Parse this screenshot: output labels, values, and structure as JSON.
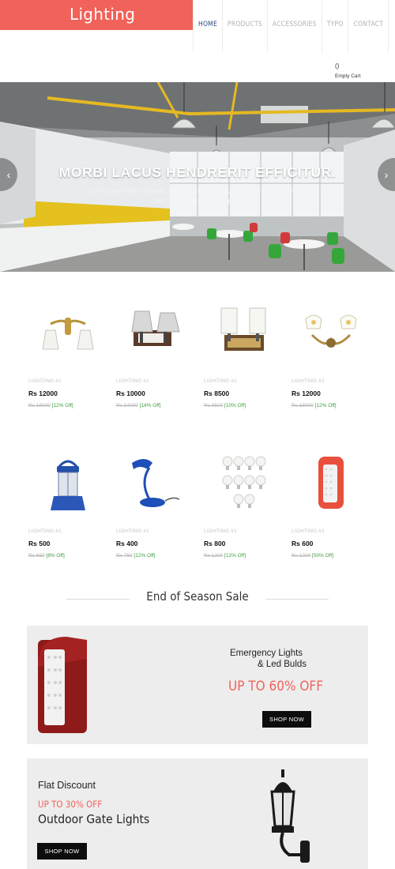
{
  "header": {
    "logo": "Lighting",
    "nav": [
      "HOME",
      "PRODUCTS",
      "ACCESSORIES",
      "TYPO",
      "CONTACT"
    ],
    "cart_count": "()",
    "cart_label": "Empty Cart"
  },
  "hero": {
    "title": "MORBI LACUS HENDRERIT EFFICITUR.",
    "subtitle": "Lorem ipsum dolor sit amet, consectetur adipiscing elit, consectetur adipiscing elit, consectetur adipiscing elit",
    "prev_icon": "‹",
    "next_icon": "›"
  },
  "products": [
    {
      "category": "LIGHTING #1",
      "price": "Rs 12000",
      "old_price": "Rs 18000",
      "discount": "[12% Off]",
      "icon": "double-wall-lamp-icon"
    },
    {
      "category": "LIGHTING #1",
      "price": "Rs 10000",
      "old_price": "Rs 14000",
      "discount": "[14% Off]",
      "icon": "shade-wall-lamp-icon"
    },
    {
      "category": "LIGHTING #1",
      "price": "Rs 8500",
      "old_price": "Rs 9500",
      "discount": "[10% Off]",
      "icon": "square-wall-lamp-icon"
    },
    {
      "category": "LIGHTING #1",
      "price": "Rs 12000",
      "old_price": "Rs 18000",
      "discount": "[12% Off]",
      "icon": "brass-wall-lamp-icon"
    },
    {
      "category": "LIGHTING #1",
      "price": "Rs 500",
      "old_price": "Rs 650",
      "discount": "[8% Off]",
      "icon": "lantern-icon"
    },
    {
      "category": "LIGHTING #1",
      "price": "Rs 400",
      "old_price": "Rs 750",
      "discount": "[12% Off]",
      "icon": "desk-lamp-icon"
    },
    {
      "category": "LIGHTING #1",
      "price": "Rs 800",
      "old_price": "Rs 1200",
      "discount": "[12% Off]",
      "icon": "led-bulbs-icon"
    },
    {
      "category": "LIGHTING #1",
      "price": "Rs 600",
      "old_price": "Rs 1200",
      "discount": "[50% Off]",
      "icon": "emergency-light-icon"
    }
  ],
  "sale": {
    "title": "End of Season Sale",
    "banner1": {
      "line1": "Emergency Lights",
      "line2": "& Led Bulds",
      "offer": "UP TO 60% OFF",
      "button": "SHOP NOW"
    },
    "banner2": {
      "line1": "Flat Discount",
      "offer": "UP TO 30% OFF",
      "line2": "Outdoor Gate Lights",
      "button": "SHOP NOW"
    }
  },
  "colors": {
    "brand": "#f0625a",
    "nav_active": "#2f4a82",
    "discount_green": "#3f9c3f"
  }
}
